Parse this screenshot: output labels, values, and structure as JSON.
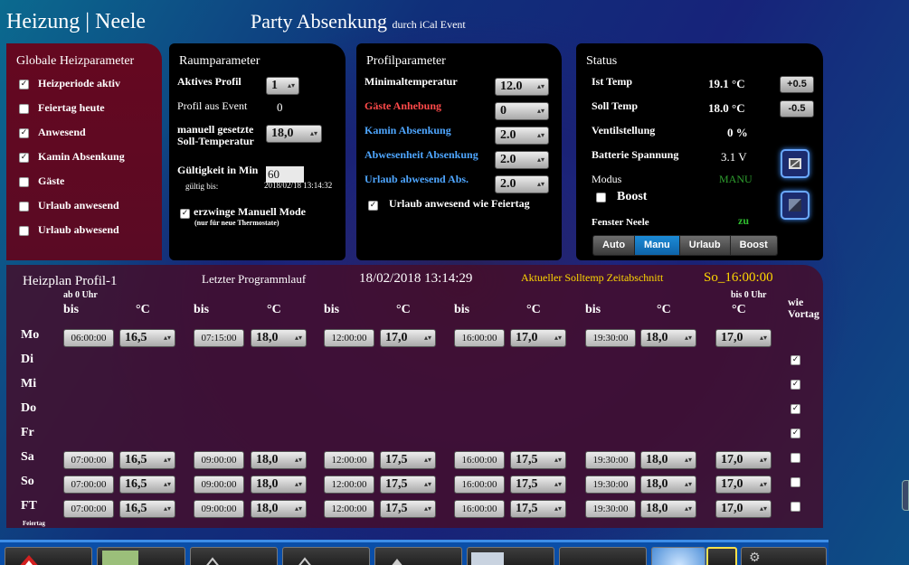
{
  "header": {
    "title": "Heizung | Neele",
    "party_main": "Party Absenkung",
    "party_small": "durch iCal Event"
  },
  "globale": {
    "title": "Globale Heizparameter",
    "items": [
      {
        "label": "Heizperiode aktiv",
        "checked": true
      },
      {
        "label": "Feiertag heute",
        "checked": false
      },
      {
        "label": "Anwesend",
        "checked": true
      },
      {
        "label": "Kamin Absenkung",
        "checked": true
      },
      {
        "label": "Gäste",
        "checked": false
      },
      {
        "label": "Urlaub anwesend",
        "checked": false
      },
      {
        "label": "Urlaub abwesend",
        "checked": false
      }
    ]
  },
  "raum": {
    "title": "Raumparameter",
    "aktives_profil_label": "Aktives Profil",
    "aktives_profil_value": "1",
    "profil_event_label": "Profil aus Event",
    "profil_event_value": "0",
    "manuell_label_1": "manuell gesetzte",
    "manuell_label_2": "Soll-Temperatur",
    "manuell_value": "18,0",
    "gueltig_label": "Gültigkeit in Min",
    "gueltig_value": "60",
    "gueltig_bis_label": "gültig bis:",
    "gueltig_bis_value": "2018/02/18 13:14:32",
    "erzwinge_label": "erzwinge Manuell Mode",
    "erzwinge_sub": "(nur für neue Thermostate)",
    "erzwinge_checked": true
  },
  "profil": {
    "title": "Profilparameter",
    "rows": [
      {
        "label": "Minimaltemperatur",
        "value": "12.0"
      },
      {
        "label": "Gäste Anhebung",
        "value": "0"
      },
      {
        "label": "Kamin Absenkung",
        "value": "2.0"
      },
      {
        "label": "Abwesenheit Absenkung",
        "value": "2.0"
      },
      {
        "label": "Urlaub abwesend Abs.",
        "value": "2.0"
      }
    ],
    "urlaub_feiertag_label": "Urlaub anwesend wie Feiertag",
    "urlaub_feiertag_checked": true
  },
  "status": {
    "title": "Status",
    "ist_temp_label": "Ist Temp",
    "ist_temp_value": "19.1 °C",
    "plus_button": "+0.5",
    "soll_temp_label": "Soll Temp",
    "soll_temp_value": "18.0 °C",
    "minus_button": "-0.5",
    "ventil_label": "Ventilstellung",
    "ventil_value": "0 %",
    "batterie_label": "Batterie Spannung",
    "batterie_value": "3.1 V",
    "modus_label": "Modus",
    "modus_value": "MANU",
    "boost_label": "Boost",
    "boost_checked": false,
    "fenster_label": "Fenster Neele",
    "fenster_value": "zu",
    "modes": [
      "Auto",
      "Manu",
      "Urlaub",
      "Boost"
    ],
    "active_mode": "Manu"
  },
  "plan": {
    "title": "Heizplan Profil-1",
    "letzter_label": "Letzter Programmlauf",
    "letzter_value": "18/02/2018 13:14:29",
    "aktuell_label": "Aktueller Solltemp Zeitabschnitt",
    "aktuell_value": "So_16:00:00",
    "ab_label": "ab 0 Uhr",
    "bis0_label": "bis 0 Uhr",
    "bis_label": "bis",
    "deg_label": "°C",
    "wie_label": "wie",
    "vortag_label": "Vortag",
    "feiertag_small": "Feiertag",
    "rows": [
      {
        "day": "Mo",
        "times": [
          "06:00:00",
          "07:15:00",
          "12:00:00",
          "16:00:00",
          "19:30:00"
        ],
        "temps": [
          "16,5",
          "18,0",
          "17,0",
          "17,0",
          "18,0",
          "17,0"
        ],
        "wie": null
      },
      {
        "day": "Di",
        "times": null,
        "temps": null,
        "wie": true
      },
      {
        "day": "Mi",
        "times": null,
        "temps": null,
        "wie": true
      },
      {
        "day": "Do",
        "times": null,
        "temps": null,
        "wie": true
      },
      {
        "day": "Fr",
        "times": null,
        "temps": null,
        "wie": true
      },
      {
        "day": "Sa",
        "times": [
          "07:00:00",
          "09:00:00",
          "12:00:00",
          "16:00:00",
          "19:30:00"
        ],
        "temps": [
          "16,5",
          "18,0",
          "17,5",
          "17,5",
          "18,0",
          "17,0"
        ],
        "wie": false
      },
      {
        "day": "So",
        "times": [
          "07:00:00",
          "09:00:00",
          "12:00:00",
          "16:00:00",
          "19:30:00"
        ],
        "temps": [
          "16,5",
          "18,0",
          "17,5",
          "17,5",
          "18,0",
          "17,0"
        ],
        "wie": false
      },
      {
        "day": "FT",
        "times": [
          "07:00:00",
          "09:00:00",
          "12:00:00",
          "16:00:00",
          "19:30:00"
        ],
        "temps": [
          "16,5",
          "18,0",
          "17,5",
          "17,5",
          "18,0",
          "17,0"
        ],
        "wie": false
      }
    ]
  },
  "colors": {
    "accent_blue": "#1c8bd6",
    "label_red": "#ff4a4a",
    "label_blue": "#4ea6ff",
    "status_green": "#2fbf2f",
    "highlight_yellow": "#ffd700"
  }
}
